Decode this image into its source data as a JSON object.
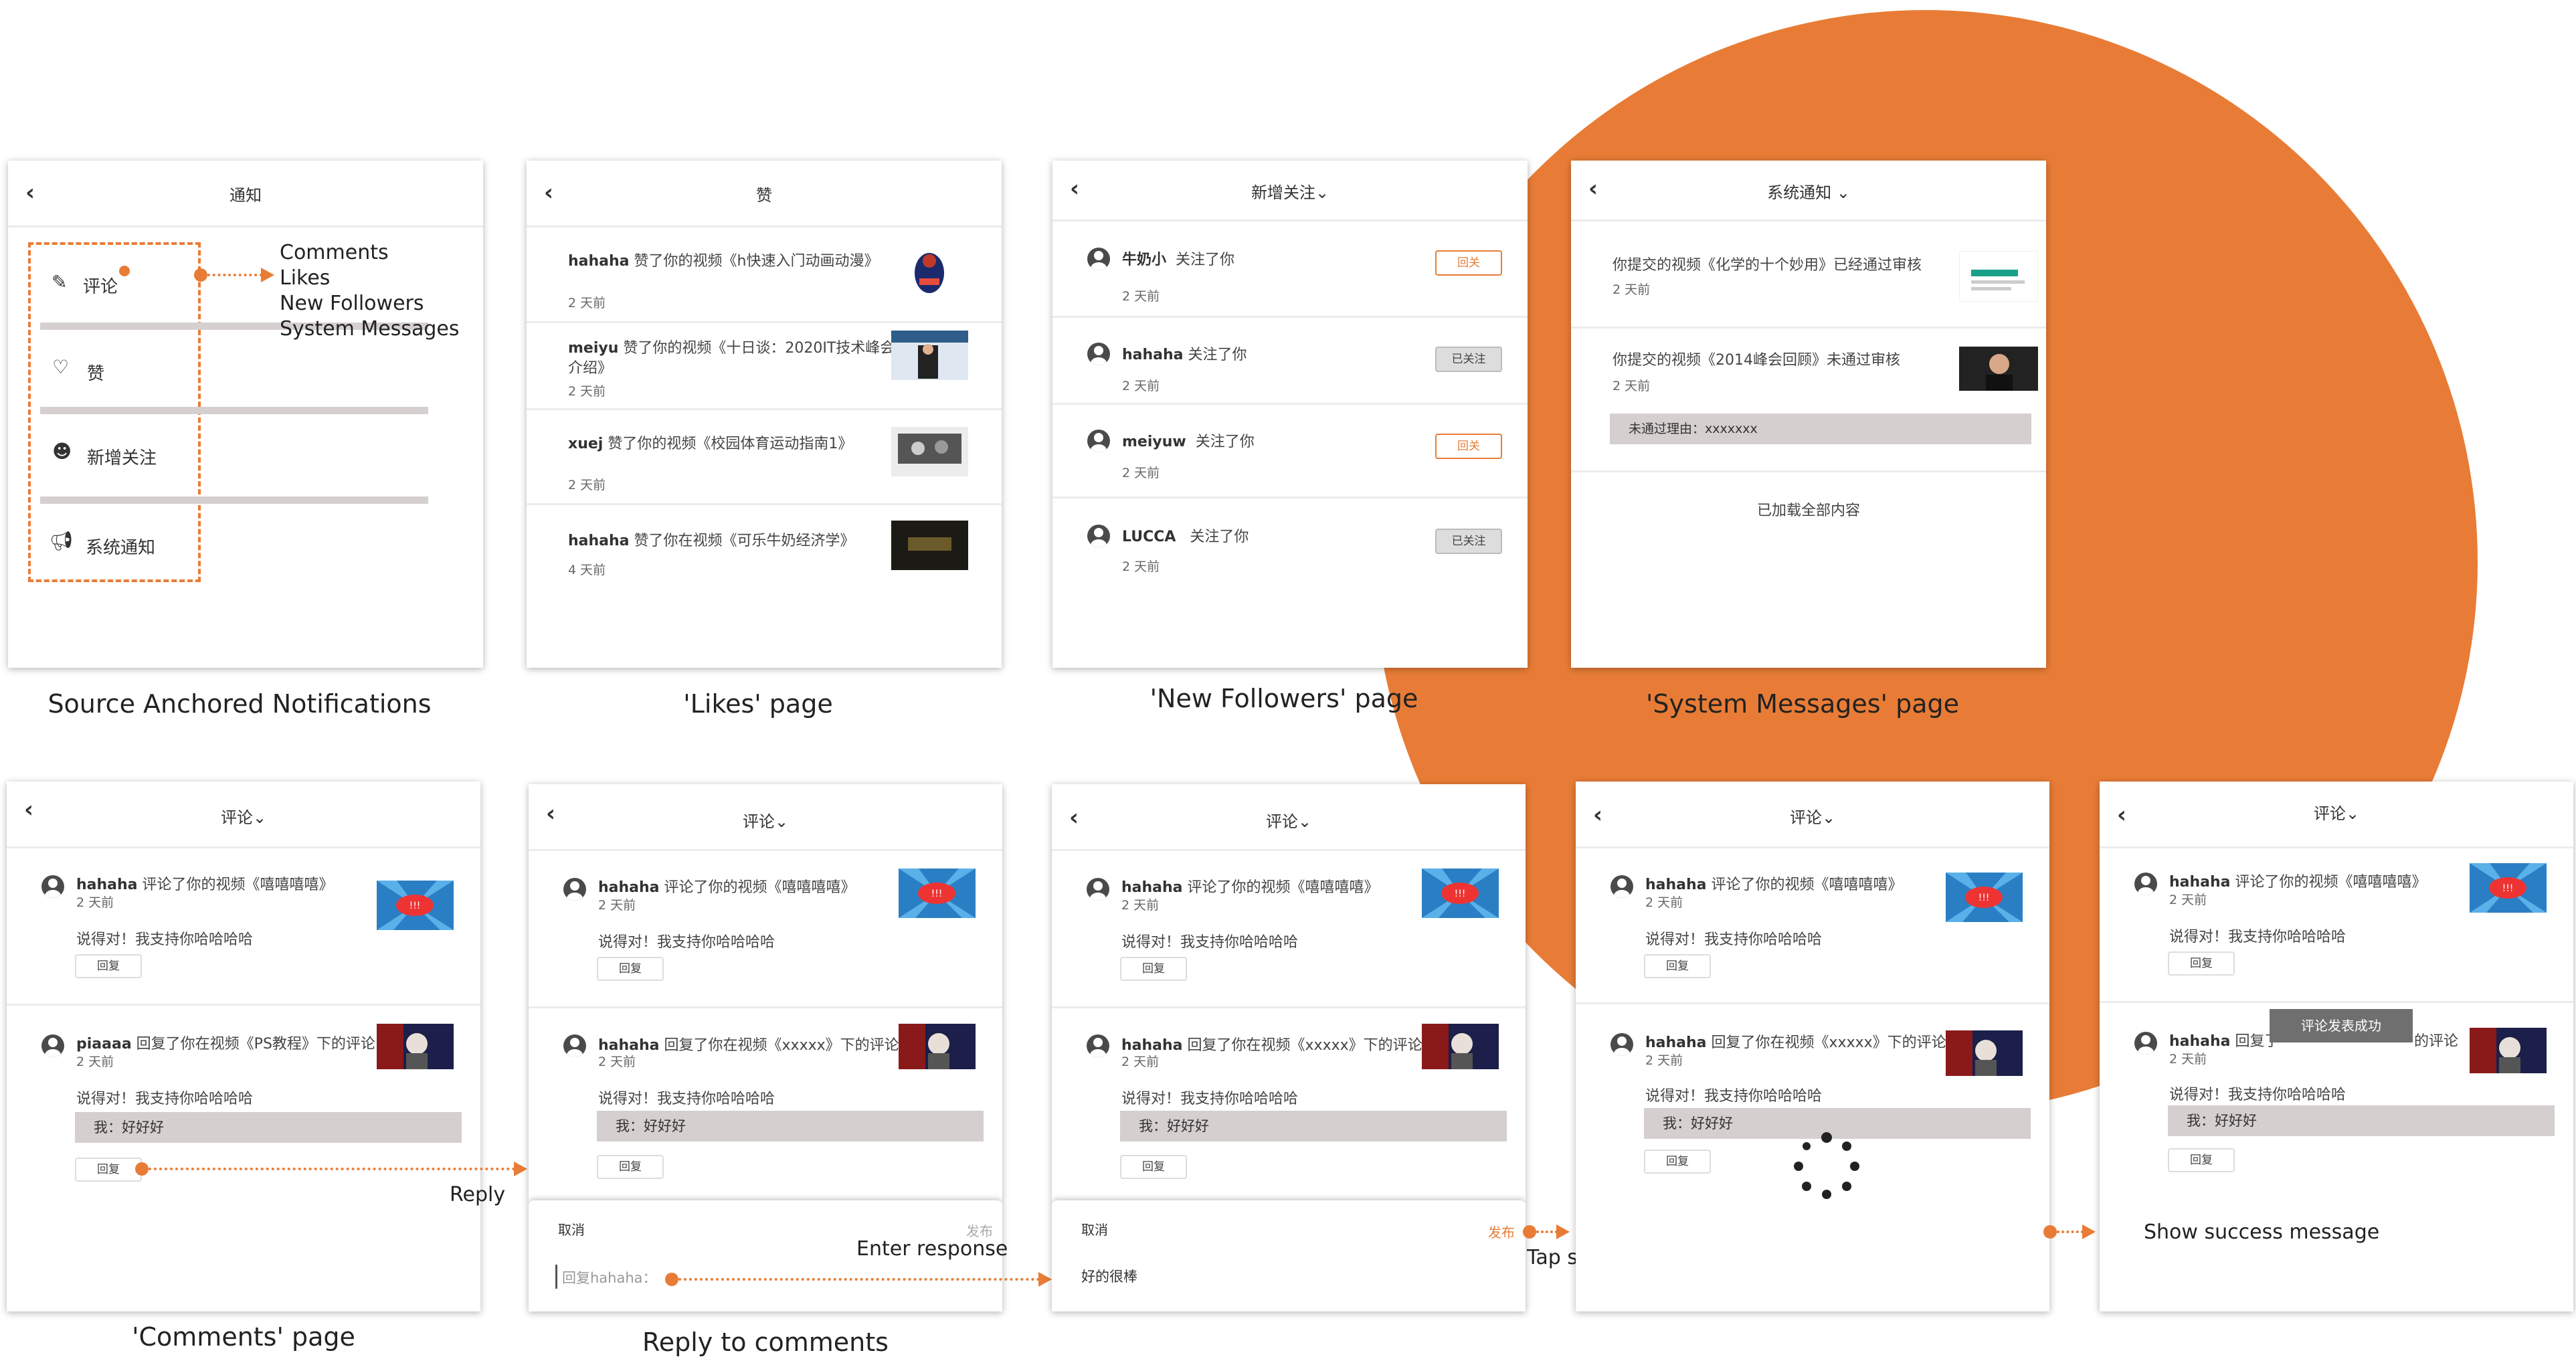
{
  "captions": {
    "source": "Source Anchored Notifications",
    "likes": "'Likes' page",
    "followers": "'New Followers' page",
    "system": "'System Messages' page",
    "comments": "'Comments' page",
    "reply": "Reply to comments"
  },
  "annotations": {
    "legend": [
      "Comments",
      "Likes",
      "New Followers",
      "System Messages"
    ],
    "reply": "Reply",
    "enter_response": "Enter response",
    "tap_send": "Tap send",
    "show_success": "Show success message"
  },
  "colors": {
    "accent": "#E87C36",
    "quote_bg": "#d6cfcf",
    "circle": "#E87C36"
  },
  "icons": {
    "back": "‹"
  },
  "notif": {
    "title": "通知",
    "items": [
      {
        "label": "评论",
        "icon": "pen-icon"
      },
      {
        "label": "赞",
        "icon": "heart-icon"
      },
      {
        "label": "新增关注",
        "icon": "smiley-icon"
      },
      {
        "label": "系统通知",
        "icon": "megaphone-icon"
      }
    ]
  },
  "likes": {
    "title": "赞",
    "items": [
      {
        "user": "hahaha",
        "text": "赞了你的视频《h快速入门动画动漫》",
        "time": "2 天前"
      },
      {
        "user": "meiyu",
        "text": "赞了你的视频《十日谈：2020IT技术峰会",
        "text2": "介绍》",
        "time": "2 天前"
      },
      {
        "user": "xuej",
        "text": "赞了你的视频《校园体育运动指南1》",
        "time": "2 天前"
      },
      {
        "user": "hahaha",
        "text": "赞了你在视频《可乐牛奶经济学》",
        "time": "4 天前"
      }
    ]
  },
  "followers": {
    "title": "新增关注",
    "items": [
      {
        "user": "牛奶小",
        "text": "关注了你",
        "time": "2 天前",
        "button": "回关",
        "state": "orange"
      },
      {
        "user": "hahaha",
        "text": "关注了你",
        "time": "2 天前",
        "button": "已关注",
        "state": "grey"
      },
      {
        "user": "meiyuw",
        "text": "关注了你",
        "time": "2 天前",
        "button": "回关",
        "state": "orange"
      },
      {
        "user": "LUCCA",
        "text": "关注了你",
        "time": "2 天前",
        "button": "已关注",
        "state": "grey"
      }
    ]
  },
  "system": {
    "title": "系统通知",
    "items": [
      {
        "text": "你提交的视频《化学的十个妙用》已经通过审核",
        "time": "2 天前"
      },
      {
        "text": "你提交的视频《2014峰会回顾》未通过审核",
        "time": "2 天前",
        "reason": "未通过理由：xxxxxxx"
      }
    ],
    "footer": "已加载全部内容"
  },
  "comments": {
    "title": "评论",
    "reply_label": "回复",
    "comment_text": "说得对！我支持你哈哈哈哈",
    "my_reply": "我：好好好",
    "first": {
      "user": "hahaha",
      "text": "评论了你的视频《嘻嘻嘻嘻》",
      "time": "2 天前"
    },
    "second_variants": [
      {
        "user": "piaaaa",
        "text": "回复了你在视频《PS教程》下的评论",
        "time": "2 天前"
      },
      {
        "user": "hahaha",
        "text": "回复了你在视频《xxxxx》下的评论",
        "time": "2 天前"
      }
    ],
    "cancel": "取消",
    "publish": "发布",
    "reply_placeholder": "回复hahaha：",
    "typed_text": "好的很棒",
    "toast": "评论发表成功",
    "second_left": "回复了",
    "second_right": "的评论"
  }
}
